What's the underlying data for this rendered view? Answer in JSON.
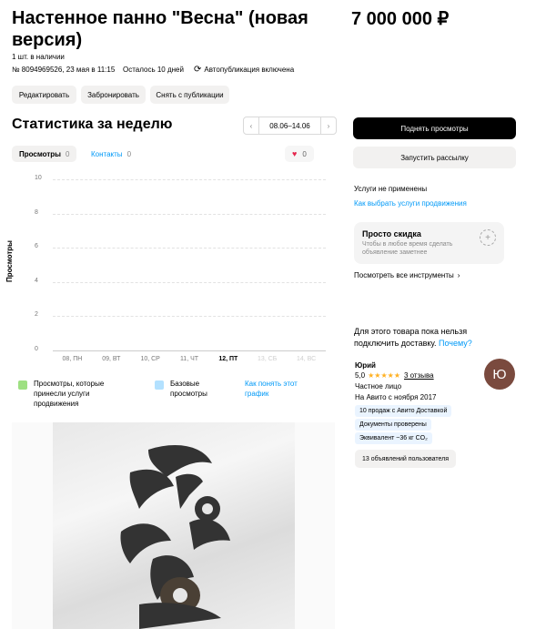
{
  "listing": {
    "title": "Настенное панно \"Весна\" (новая версия)",
    "price": "7 000 000 ₽",
    "stock": "1 шт. в наличии",
    "id_date": "№ 8094969526, 23 мая в 11:15",
    "days_left": "Осталось 10 дней",
    "autopub": "Автопубликация включена"
  },
  "actions": {
    "edit": "Редактировать",
    "reserve": "Забронировать",
    "unpublish": "Снять с публикации"
  },
  "stats": {
    "title": "Статистика за неделю",
    "date_range": "08.06–14.06",
    "tabs": [
      {
        "label": "Просмотры",
        "count": "0"
      },
      {
        "label": "Контакты",
        "count": "0"
      }
    ],
    "favorites": "0",
    "y_axis_label": "Просмотры",
    "legend": {
      "paid": "Просмотры, которые принесли услуги продвижения",
      "base": "Базовые просмотры",
      "help": "Как понять этот график"
    }
  },
  "chart_data": {
    "type": "bar",
    "categories": [
      "08, ПН",
      "09, ВТ",
      "10, СР",
      "11, ЧТ",
      "12, ПТ",
      "13, СБ",
      "14, ВС"
    ],
    "series": [
      {
        "name": "Просмотры, которые принесли услуги продвижения",
        "values": [
          0,
          0,
          0,
          0,
          0,
          null,
          null
        ]
      },
      {
        "name": "Базовые просмотры",
        "values": [
          0,
          0,
          0,
          0,
          0,
          null,
          null
        ]
      }
    ],
    "ylim": [
      0,
      10
    ],
    "yticks": [
      0,
      2,
      4,
      6,
      8,
      10
    ],
    "ylabel": "Просмотры",
    "grid": true
  },
  "sidebar": {
    "raise_views": "Поднять просмотры",
    "mailing": "Запустить рассылку",
    "no_services": "Услуги не применены",
    "choose_services": "Как выбрать услуги продвижения",
    "discount_title": "Просто скидка",
    "discount_desc": "Чтобы в любое время сделать объявление заметнее",
    "all_tools": "Посмотреть все инструменты",
    "delivery_text": "Для этого товара пока нельзя подключить доставку.",
    "delivery_link": "Почему?"
  },
  "seller": {
    "name": "Юрий",
    "rating": "5,0",
    "stars": "★★★★★",
    "reviews": "3 отзыва",
    "type": "Частное лицо",
    "since": "На Авито с ноября 2017",
    "badges": [
      "10 продаж с Авито Доставкой",
      "Документы проверены",
      "Эквивалент ~36 кг CO₂"
    ],
    "listings": "13 объявлений пользователя",
    "avatar_letter": "Ю"
  },
  "colors": {
    "accent": "#0099f7",
    "brand_dark": "#000000",
    "avatar": "#7a4a3e",
    "legend_green": "#9ee082",
    "legend_blue": "#b3e1ff"
  }
}
